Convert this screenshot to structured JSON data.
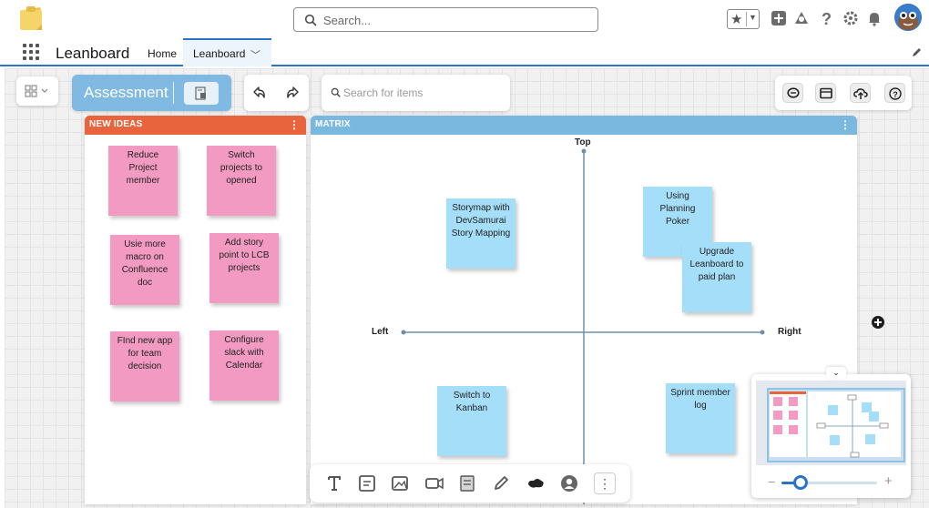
{
  "header": {
    "search_placeholder": "Search...",
    "app_name": "Leanboard",
    "home_tab": "Home",
    "active_tab": "Leanboard"
  },
  "board": {
    "title": "Assessment",
    "item_search_placeholder": "Search for items"
  },
  "frames": {
    "new_ideas": {
      "label": "NEW IDEAS",
      "notes": [
        "Reduce Project member",
        "Switch projects to opened",
        "Usie more macro on Confluence doc",
        "Add story point to LCB projects",
        "FInd new app for team decision",
        "Configure slack with Calendar"
      ]
    },
    "matrix": {
      "label": "MATRIX",
      "axes": {
        "top": "Top",
        "left": "Left",
        "right": "Right"
      },
      "notes": [
        "Storymap with DevSamurai Story Mapping",
        "Using Planning Poker",
        "Upgrade Leanboard to paid plan",
        "Switch to Kanban",
        "Sprint member log"
      ]
    }
  },
  "minimap": {
    "zoom_level": 0.2
  },
  "colors": {
    "brand_blue": "#2a73c9",
    "new_ideas_header": "#e8643c",
    "matrix_header": "#7ab8e0",
    "sticky_pink": "#f29ac2",
    "sticky_blue": "#a5def8"
  },
  "icons": {
    "topbar": [
      "favorites-star-icon",
      "add-icon",
      "trailhead-icon",
      "help-icon",
      "setup-gear-icon",
      "notification-bell-icon"
    ],
    "board_tools": [
      "comment-icon",
      "panel-icon",
      "cloud-upload-icon",
      "help-circle-icon"
    ],
    "bottom_tools": [
      "text-icon",
      "sticky-note-icon",
      "image-icon",
      "video-icon",
      "template-icon",
      "pen-icon",
      "shape-icon",
      "user-icon",
      "more-icon"
    ]
  }
}
